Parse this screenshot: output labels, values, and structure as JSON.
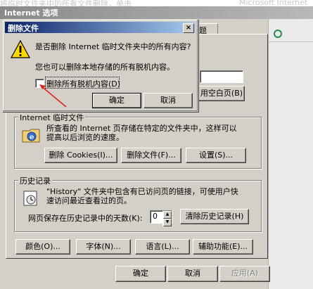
{
  "background_title_fragment": "将临时文件夹中的所有文件删除，单击",
  "background_suffix": "Microsoft Internet",
  "main_window": {
    "title": "Internet 选项",
    "tab_fragment": "题",
    "set_button": "用空白页(B)",
    "temp_files": {
      "legend": "Internet 临时文件",
      "description_line1": "所查看的 Internet 页存储在特定的文件夹中，这样可以",
      "description_line2": "提高以后浏览的速度。",
      "delete_cookies": "删除 Cookies(I)...",
      "delete_files": "删除文件(F)...",
      "settings": "设置(S)..."
    },
    "history": {
      "legend": "历史记录",
      "description_line1": "\"History\" 文件夹中包含有已访问页的链接，可使用户快",
      "description_line2": "速访问最近查看过的页。",
      "days_label": "网页保存在历史记录中的天数(K):",
      "days_value": "0",
      "clear_history": "清除历史记录(H)"
    },
    "bottom_buttons": {
      "colors": "颜色(O)...",
      "fonts": "字体(N)...",
      "languages": "语言(L)...",
      "accessibility": "辅助功能(E)..."
    },
    "ok": "确定",
    "cancel": "取消",
    "apply": "应用(A)"
  },
  "delete_dialog": {
    "title": "删除文件",
    "close_glyph": "×",
    "question": "是否删除 Internet 临时文件夹中的所有内容?",
    "info": "您也可以删除本地存储的所有脱机内容。",
    "checkbox_label": "删除所有脱机内容(D)",
    "checkbox_checked": false,
    "ok": "确定",
    "cancel": "取消"
  },
  "colors": {
    "dialog_titlebar": "#0a246a",
    "annotation_arrow": "#e02020",
    "warning_yellow": "#ffd800"
  }
}
